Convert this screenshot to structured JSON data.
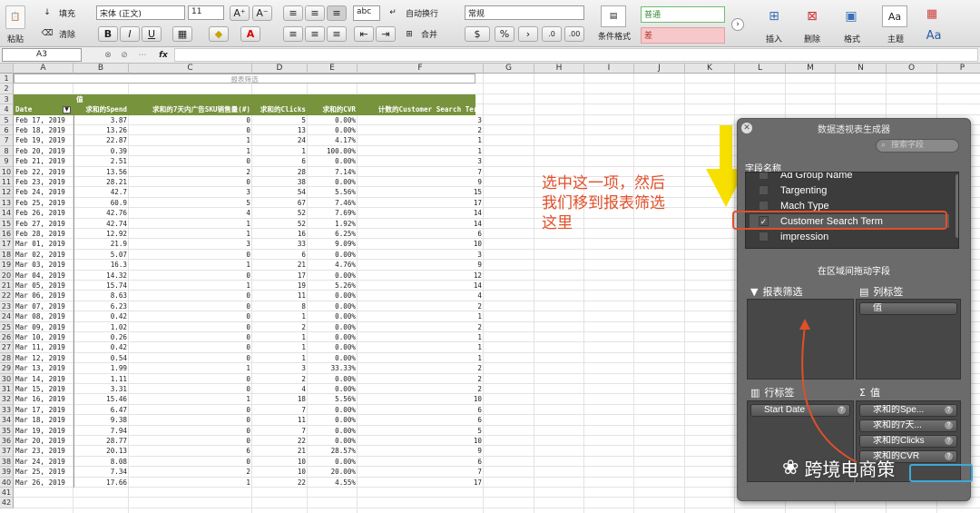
{
  "ribbon": {
    "paste": "粘贴",
    "fill": "填充",
    "clear": "清除",
    "font_name": "宋体 (正文)",
    "font_size": "11",
    "wrap": "自动换行",
    "abc": "abc",
    "merge": "合并",
    "number_format": "常规",
    "percent": "%",
    "cond_format": "条件格式",
    "style_normal": "普通",
    "style_bad": "差",
    "insert": "插入",
    "delete": "删除",
    "format": "格式",
    "theme": "主题"
  },
  "formula_bar": {
    "name_box": "A3",
    "fx": "fx",
    "formula": ""
  },
  "columns": [
    "A",
    "B",
    "C",
    "D",
    "E",
    "F",
    "G",
    "H",
    "I",
    "J",
    "K",
    "L",
    "M",
    "N",
    "O",
    "P"
  ],
  "sheet": {
    "report_filter_label": "报表筛选",
    "values_header": "值",
    "headers": [
      "Date",
      "求和的Spend",
      "求和的7天内广告SKU销售量(#)",
      "求和的Clicks",
      "求和的CVR",
      "计数的Customer Search Term"
    ],
    "rows": [
      [
        "Feb 17, 2019",
        "3.87",
        "0",
        "5",
        "0.00%",
        "3"
      ],
      [
        "Feb 18, 2019",
        "13.26",
        "0",
        "13",
        "0.00%",
        "2"
      ],
      [
        "Feb 19, 2019",
        "22.87",
        "1",
        "24",
        "4.17%",
        "1"
      ],
      [
        "Feb 20, 2019",
        "0.39",
        "1",
        "1",
        "100.00%",
        "1"
      ],
      [
        "Feb 21, 2019",
        "2.51",
        "0",
        "6",
        "0.00%",
        "3"
      ],
      [
        "Feb 22, 2019",
        "13.56",
        "2",
        "28",
        "7.14%",
        "7"
      ],
      [
        "Feb 23, 2019",
        "28.21",
        "0",
        "38",
        "0.00%",
        "9"
      ],
      [
        "Feb 24, 2019",
        "42.7",
        "3",
        "54",
        "5.56%",
        "15"
      ],
      [
        "Feb 25, 2019",
        "60.9",
        "5",
        "67",
        "7.46%",
        "17"
      ],
      [
        "Feb 26, 2019",
        "42.76",
        "4",
        "52",
        "7.69%",
        "14"
      ],
      [
        "Feb 27, 2019",
        "42.74",
        "1",
        "52",
        "1.92%",
        "14"
      ],
      [
        "Feb 28, 2019",
        "12.92",
        "1",
        "16",
        "6.25%",
        "6"
      ],
      [
        "Mar 01, 2019",
        "21.9",
        "3",
        "33",
        "9.09%",
        "10"
      ],
      [
        "Mar 02, 2019",
        "5.07",
        "0",
        "6",
        "0.00%",
        "3"
      ],
      [
        "Mar 03, 2019",
        "16.3",
        "1",
        "21",
        "4.76%",
        "9"
      ],
      [
        "Mar 04, 2019",
        "14.32",
        "0",
        "17",
        "0.00%",
        "12"
      ],
      [
        "Mar 05, 2019",
        "15.74",
        "1",
        "19",
        "5.26%",
        "14"
      ],
      [
        "Mar 06, 2019",
        "8.63",
        "0",
        "11",
        "0.00%",
        "4"
      ],
      [
        "Mar 07, 2019",
        "6.23",
        "0",
        "8",
        "0.00%",
        "2"
      ],
      [
        "Mar 08, 2019",
        "0.42",
        "0",
        "1",
        "0.00%",
        "1"
      ],
      [
        "Mar 09, 2019",
        "1.02",
        "0",
        "2",
        "0.00%",
        "2"
      ],
      [
        "Mar 10, 2019",
        "0.26",
        "0",
        "1",
        "0.00%",
        "1"
      ],
      [
        "Mar 11, 2019",
        "0.42",
        "0",
        "1",
        "0.00%",
        "1"
      ],
      [
        "Mar 12, 2019",
        "0.54",
        "0",
        "1",
        "0.00%",
        "1"
      ],
      [
        "Mar 13, 2019",
        "1.99",
        "1",
        "3",
        "33.33%",
        "2"
      ],
      [
        "Mar 14, 2019",
        "1.11",
        "0",
        "2",
        "0.00%",
        "2"
      ],
      [
        "Mar 15, 2019",
        "3.31",
        "0",
        "4",
        "0.00%",
        "2"
      ],
      [
        "Mar 16, 2019",
        "15.46",
        "1",
        "18",
        "5.56%",
        "10"
      ],
      [
        "Mar 17, 2019",
        "6.47",
        "0",
        "7",
        "0.00%",
        "6"
      ],
      [
        "Mar 18, 2019",
        "9.38",
        "0",
        "11",
        "0.00%",
        "6"
      ],
      [
        "Mar 19, 2019",
        "7.94",
        "0",
        "7",
        "0.00%",
        "5"
      ],
      [
        "Mar 20, 2019",
        "28.77",
        "0",
        "22",
        "0.00%",
        "10"
      ],
      [
        "Mar 23, 2019",
        "20.13",
        "6",
        "21",
        "28.57%",
        "9"
      ],
      [
        "Mar 24, 2019",
        "8.08",
        "0",
        "10",
        "0.00%",
        "6"
      ],
      [
        "Mar 25, 2019",
        "7.34",
        "2",
        "10",
        "20.00%",
        "7"
      ],
      [
        "Mar 26, 2019",
        "17.66",
        "1",
        "22",
        "4.55%",
        "17"
      ]
    ]
  },
  "annotation": {
    "line1": "选中这一项，然后",
    "line2": "我们移到报表筛选",
    "line3": "这里"
  },
  "panel": {
    "title": "数据透视表生成器",
    "search_placeholder": "搜索字段",
    "field_name_label": "字段名称",
    "fields": [
      {
        "label": "Ad Group Name",
        "checked": false
      },
      {
        "label": "Targenting",
        "checked": false
      },
      {
        "label": "Mach Type",
        "checked": false
      },
      {
        "label": "Customer Search Term",
        "checked": true
      },
      {
        "label": "impression",
        "checked": false
      }
    ],
    "drag_hint": "在区域间拖动字段",
    "report_filter": "报表筛选",
    "column_labels": "列标签",
    "column_values_pill": "值",
    "row_labels": "行标签",
    "row_pill": "Start Date",
    "values": "值",
    "value_pills": [
      "求和的Spe...",
      "求和的7天...",
      "求和的Clicks",
      "求和的CVR"
    ]
  },
  "watermark": "跨境电商策",
  "colors": {
    "header_green": "#77933c",
    "highlight_red": "#e0502a",
    "arrow_yellow": "#f7e000"
  }
}
